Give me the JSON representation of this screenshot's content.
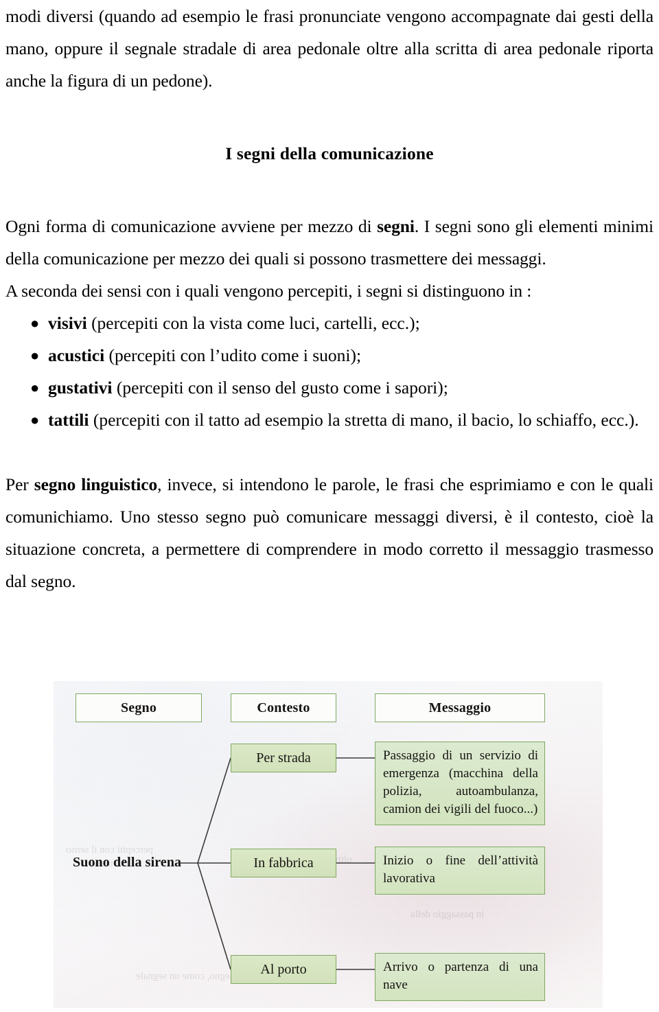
{
  "document": {
    "paragraph_top": {
      "text": "modi diversi (quando ad esempio le frasi pronunciate vengono accompagnate dai gesti della mano, oppure il segnale stradale di area pedonale oltre alla scritta di area pedonale riporta anche la figura di un pedone)."
    },
    "heading": "I segni della comunicazione",
    "paragraph_intro": {
      "part1": "Ogni forma di comunicazione avviene per mezzo di ",
      "bold1": "segni",
      "part2": ". I segni sono gli elementi minimi della comunicazione per mezzo dei quali si possono trasmettere dei messaggi."
    },
    "paragraph_senses": "A seconda dei sensi con i quali vengono percepiti, i segni si distinguono in :",
    "bullet_glyph": "●",
    "bullets": [
      {
        "term": "visivi",
        "rest": " (percepiti con la vista come luci, cartelli, ecc.);"
      },
      {
        "term": "acustici",
        "rest": " (percepiti con l’udito come i suoni);"
      },
      {
        "term": "gustativi",
        "rest": " (percepiti con il senso del gusto come i sapori);"
      },
      {
        "term": "tattili",
        "rest": " (percepiti con il tatto ad esempio la stretta di mano, il bacio, lo schiaffo, ecc.)."
      }
    ],
    "paragraph_linguistic": {
      "part1": "Per ",
      "bold1": "segno linguistico",
      "part2": ", invece, si intendono le parole, le frasi che esprimiamo e con le quali comunichiamo. Uno stesso segno può comunicare messaggi diversi, è il contesto, cioè la situazione concreta, a permettere di comprendere in modo corretto il messaggio trasmesso dal segno."
    }
  },
  "figure": {
    "headers": {
      "segno": "Segno",
      "contesto": "Contesto",
      "messaggio": "Messaggio"
    },
    "sign_label": "Suono della sirena",
    "rows": [
      {
        "context": "Per strada",
        "message": "Passaggio di un servizio di emergenza (macchina della polizia, autoambulanza, camion dei vigili del fuoco...)"
      },
      {
        "context": "In fabbrica",
        "message": "Inizio o fine dell’attività lavorativa"
      },
      {
        "context": "Al porto",
        "message": "Arrivo o partenza di una nave"
      }
    ],
    "colors": {
      "box_border": "#7fa860",
      "box_fill": "#d5e3c0",
      "header_fill": "#fcfdfb",
      "connector": "#3a3a3a"
    }
  }
}
